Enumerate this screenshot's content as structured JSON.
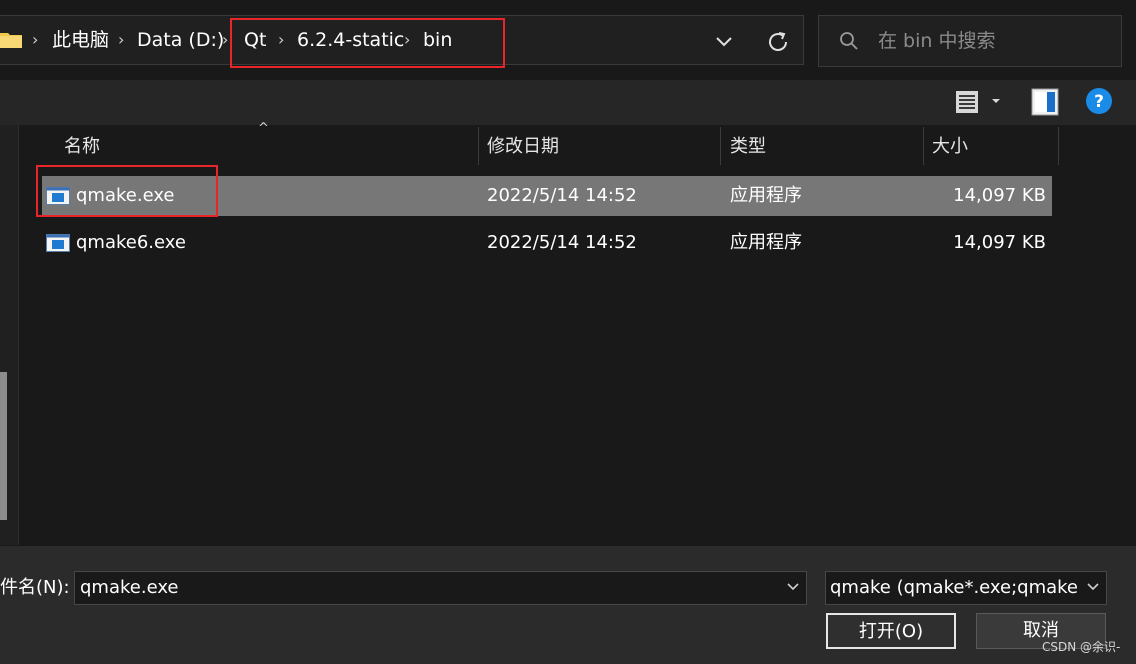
{
  "breadcrumb": {
    "items": [
      "此电脑",
      "Data (D:)",
      "Qt",
      "6.2.4-static",
      "bin"
    ],
    "separator": "›"
  },
  "search": {
    "placeholder": "在 bin 中搜索"
  },
  "icons": {
    "folder": "folder-icon",
    "history": "chevron-down-icon",
    "refresh": "refresh-icon",
    "search": "search-icon",
    "view": "view-menu-icon",
    "preview": "preview-pane-icon",
    "help": "help-icon",
    "file": "exe-app-icon"
  },
  "columns": {
    "name": "名称",
    "modified": "修改日期",
    "type": "类型",
    "size": "大小"
  },
  "files": [
    {
      "name": "qmake.exe",
      "modified": "2022/5/14 14:52",
      "type": "应用程序",
      "size": "14,097 KB",
      "selected": true
    },
    {
      "name": "qmake6.exe",
      "modified": "2022/5/14 14:52",
      "type": "应用程序",
      "size": "14,097 KB",
      "selected": false
    }
  ],
  "footer": {
    "filename_label": "件名(N):",
    "filename_value": "qmake.exe",
    "filter_value": "qmake (qmake*.exe;qmake*.bat)",
    "open_label": "打开(O)",
    "cancel_label": "取消"
  },
  "watermark": "CSDN @余识-",
  "colors": {
    "highlight_border": "#e8262a",
    "selected_row": "#777777",
    "help_blue": "#1a8ce8"
  }
}
